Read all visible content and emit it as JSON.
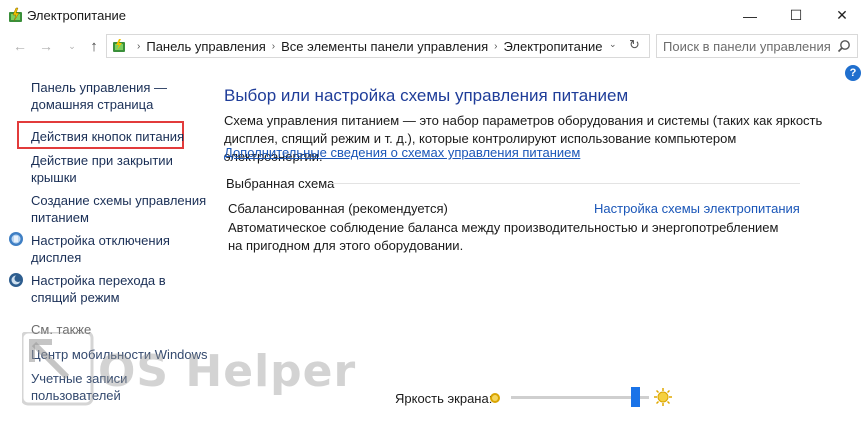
{
  "window": {
    "title": "Электропитание",
    "min_glyph": "—",
    "max_glyph": "☐",
    "close_glyph": "✕"
  },
  "nav": {
    "back_glyph": "←",
    "forward_glyph": "→",
    "recent_glyph": "⌄",
    "up_glyph": "↑",
    "breadcrumbs": [
      "Панель управления",
      "Все элементы панели управления",
      "Электропитание"
    ],
    "separator": "›",
    "dropdown_glyph": "⌄",
    "refresh_glyph": "↻"
  },
  "search": {
    "placeholder": "Поиск в панели управления"
  },
  "help": {
    "label": "?"
  },
  "sidebar": {
    "items": [
      {
        "label_line1": "Панель управления —",
        "label_line2": "домашняя страница"
      },
      {
        "label_line1": "Действия кнопок питания"
      },
      {
        "label_line1": "Действие при закрытии",
        "label_line2": "крышки"
      },
      {
        "label_line1": "Создание схемы управления",
        "label_line2": "питанием"
      },
      {
        "label_line1": "Настройка отключения",
        "label_line2": "дисплея",
        "icon": "display-icon"
      },
      {
        "label_line1": "Настройка перехода в",
        "label_line2": "спящий режим",
        "icon": "moon-icon"
      }
    ],
    "see_also": "См. также",
    "see_also_items": [
      {
        "label": "Центр мобильности Windows"
      },
      {
        "label_line1": "Учетные записи",
        "label_line2": "пользователей"
      }
    ]
  },
  "main": {
    "title": "Выбор или настройка схемы управления питанием",
    "description": "Схема управления питанием — это набор параметров оборудования и системы (таких как яркость дисплея, спящий режим и т. д.), которые контролируют использование компьютером электроэнергии.",
    "more_link": "Дополнительные сведения о схемах управления питанием",
    "section_label": "Выбранная схема",
    "plan_name": "Сбалансированная (рекомендуется)",
    "plan_settings_link": "Настройка схемы электропитания",
    "plan_description": "Автоматическое соблюдение баланса между производительностью и энергопотреблением на пригодном для этого оборудовании."
  },
  "brightness": {
    "label": "Яркость экрана:",
    "value_fraction": 0.93
  },
  "watermark": {
    "text": "OS Helper"
  },
  "colors": {
    "accent": "#1a73e8",
    "link": "#1a56b8",
    "title": "#1f3d99",
    "highlight": "#e23b3b"
  }
}
